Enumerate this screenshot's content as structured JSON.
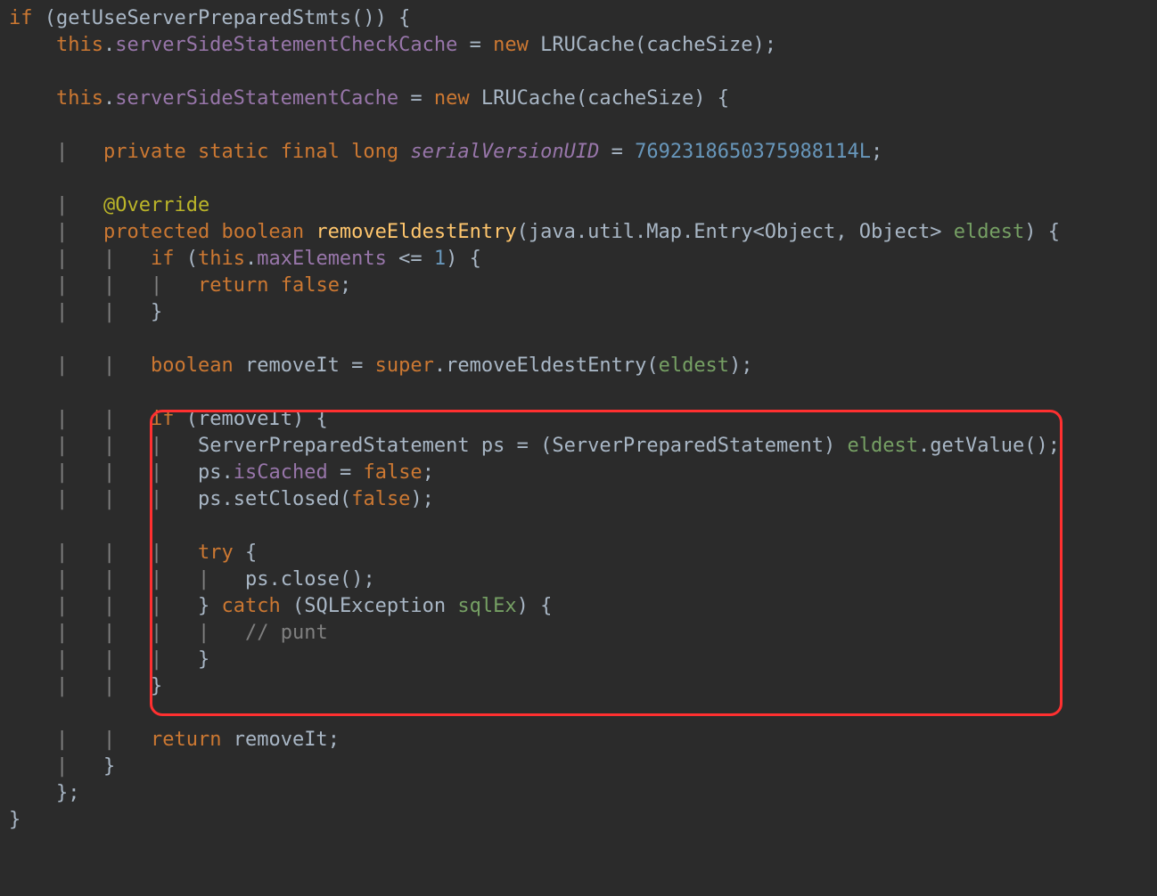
{
  "tok": {
    "if": "if",
    "getUseServerPreparedStmts": "getUseServerPreparedStmts",
    "this_": "this",
    "serverSideStatementCheckCache": "serverSideStatementCheckCache",
    "eq": " = ",
    "new_": "new",
    "LRUCache": "LRUCache",
    "cacheSize": "cacheSize",
    "serverSideStatementCache": "serverSideStatementCache",
    "private_": "private",
    "static_": "static",
    "final_": "final",
    "long_": "long",
    "serialVersionUID": "serialVersionUID",
    "svuid_num": "7692318650375988114L",
    "Override": "@Override",
    "protected_": "protected",
    "boolean_": "boolean",
    "removeEldestEntry": "removeEldestEntry",
    "javaUtilMapEntry": "java.util.Map.Entry",
    "Object_": "Object",
    "eldest": "eldest",
    "maxElements": "maxElements",
    "le1": " <= ",
    "one": "1",
    "return_": "return",
    "false_": "false",
    "removeIt": "removeIt",
    "super_": "super",
    "ServerPreparedStatement": "ServerPreparedStatement",
    "ps": "ps",
    "getValue": "getValue",
    "isCached": "isCached",
    "setClosed": "setClosed",
    "try_": "try",
    "close": "close",
    "catch_": "catch",
    "SQLException": "SQLException",
    "sqlEx": "sqlEx",
    "punt": "// punt"
  }
}
